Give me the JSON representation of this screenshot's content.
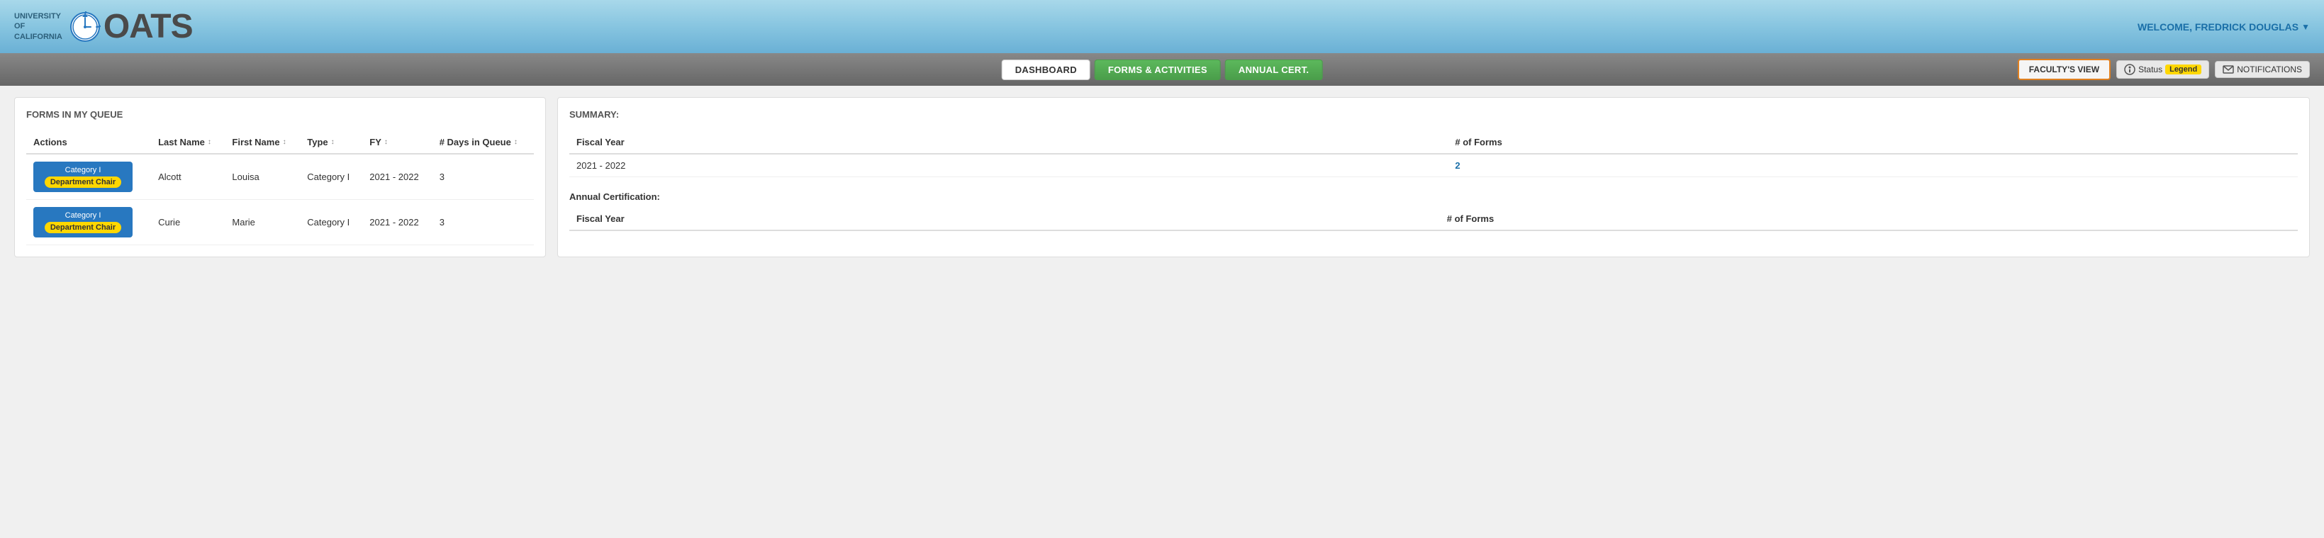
{
  "header": {
    "uc_text": "UNIVERSITY\nOF\nCALIFORNIA",
    "oats_text": "OATS",
    "welcome_text": "WELCOME, FREDRICK DOUGLAS",
    "dropdown_arrow": "▼"
  },
  "navbar": {
    "dashboard_label": "DASHBOARD",
    "forms_label": "FORMS & ACTIVITIES",
    "annual_label": "ANNUAL CERT.",
    "faculty_view_label": "FACULTY'S VIEW",
    "status_label": "Status",
    "legend_label": "Legend",
    "notifications_label": "NOTIFICATIONS"
  },
  "left_panel": {
    "title": "FORMS IN MY QUEUE",
    "columns": {
      "actions": "Actions",
      "last_name": "Last Name",
      "first_name": "First Name",
      "type": "Type",
      "fy": "FY",
      "days_in_queue": "# Days in Queue"
    },
    "rows": [
      {
        "action_top": "Category I",
        "action_badge": "Department Chair",
        "last_name": "Alcott",
        "first_name": "Louisa",
        "type": "Category I",
        "fy": "2021 - 2022",
        "days": "3"
      },
      {
        "action_top": "Category I",
        "action_badge": "Department Chair",
        "last_name": "Curie",
        "first_name": "Marie",
        "type": "Category I",
        "fy": "2021 - 2022",
        "days": "3"
      }
    ]
  },
  "right_panel": {
    "title": "SUMMARY:",
    "fiscal_year_col": "Fiscal Year",
    "num_forms_col": "# of Forms",
    "summary_rows": [
      {
        "fy": "2021 - 2022",
        "count": "2"
      }
    ],
    "annual_cert_label": "Annual Certification:",
    "annual_fy_col": "Fiscal Year",
    "annual_forms_col": "# of Forms"
  }
}
